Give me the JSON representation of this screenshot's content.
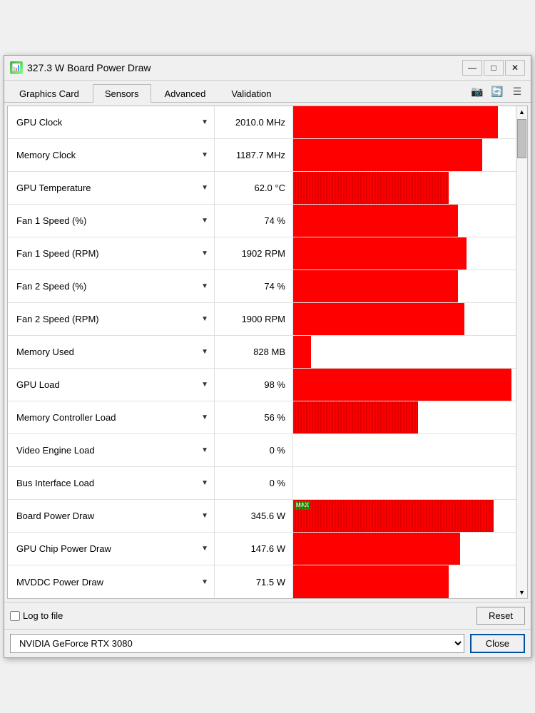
{
  "window": {
    "title": "327.3 W Board Power Draw",
    "icon": "📊"
  },
  "titlebar": {
    "minimize": "—",
    "restore": "□",
    "close": "✕"
  },
  "tabs": [
    {
      "id": "graphics-card",
      "label": "Graphics Card",
      "active": false
    },
    {
      "id": "sensors",
      "label": "Sensors",
      "active": true
    },
    {
      "id": "advanced",
      "label": "Advanced",
      "active": false
    },
    {
      "id": "validation",
      "label": "Validation",
      "active": false
    }
  ],
  "sensors": [
    {
      "name": "GPU Clock",
      "value": "2010.0 MHz",
      "bar": 92,
      "noisy": false
    },
    {
      "name": "Memory Clock",
      "value": "1187.7 MHz",
      "bar": 85,
      "noisy": false
    },
    {
      "name": "GPU Temperature",
      "value": "62.0 °C",
      "bar": 70,
      "noisy": true
    },
    {
      "name": "Fan 1 Speed (%)",
      "value": "74 %",
      "bar": 74,
      "noisy": false
    },
    {
      "name": "Fan 1 Speed (RPM)",
      "value": "1902 RPM",
      "bar": 78,
      "noisy": false
    },
    {
      "name": "Fan 2 Speed (%)",
      "value": "74 %",
      "bar": 74,
      "noisy": false
    },
    {
      "name": "Fan 2 Speed (RPM)",
      "value": "1900 RPM",
      "bar": 77,
      "noisy": false
    },
    {
      "name": "Memory Used",
      "value": "828 MB",
      "bar": 8,
      "noisy": false
    },
    {
      "name": "GPU Load",
      "value": "98 %",
      "bar": 98,
      "noisy": false
    },
    {
      "name": "Memory Controller Load",
      "value": "56 %",
      "bar": 56,
      "noisy": true
    },
    {
      "name": "Video Engine Load",
      "value": "0 %",
      "bar": 0,
      "noisy": false
    },
    {
      "name": "Bus Interface Load",
      "value": "0 %",
      "bar": 0,
      "noisy": false
    },
    {
      "name": "Board Power Draw",
      "value": "345.6 W",
      "bar": 90,
      "noisy": true,
      "maxbadge": true
    },
    {
      "name": "GPU Chip Power Draw",
      "value": "147.6 W",
      "bar": 75,
      "noisy": false
    },
    {
      "name": "MVDDC Power Draw",
      "value": "71.5 W",
      "bar": 70,
      "noisy": false
    }
  ],
  "footer": {
    "log_label": "Log to file",
    "reset_label": "Reset"
  },
  "bottom": {
    "gpu_name": "NVIDIA GeForce RTX 3080",
    "close_label": "Close"
  }
}
